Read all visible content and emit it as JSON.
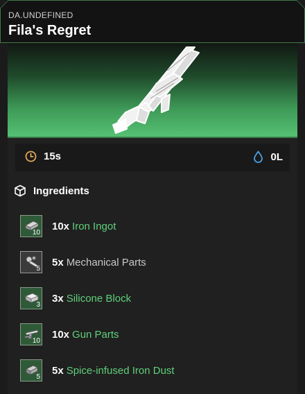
{
  "header": {
    "owner": "DA.UNDEFINED",
    "title": "Fila's Regret"
  },
  "hero": {
    "image_icon": "rifle-icon"
  },
  "stats": {
    "time": "15s",
    "time_icon": "clock-icon",
    "water": "0L",
    "water_icon": "water-drop-icon"
  },
  "ingredients_section": {
    "label": "Ingredients",
    "icon": "package-icon",
    "items": [
      {
        "count_badge": "10",
        "qty": "10x",
        "name": "Iron Ingot",
        "name_color": "#5fd07a",
        "slot_style": "green",
        "icon": "ingot-icon"
      },
      {
        "count_badge": "5",
        "qty": "5x",
        "name": "Mechanical Parts",
        "name_color": "#c8c8c8",
        "slot_style": "grey",
        "icon": "mechanical-parts-icon"
      },
      {
        "count_badge": "3",
        "qty": "3x",
        "name": "Silicone Block",
        "name_color": "#5fd07a",
        "slot_style": "green",
        "icon": "block-icon"
      },
      {
        "count_badge": "10",
        "qty": "10x",
        "name": "Gun Parts",
        "name_color": "#5fd07a",
        "slot_style": "green",
        "icon": "gun-parts-icon"
      },
      {
        "count_badge": "5",
        "qty": "5x",
        "name": "Spice-infused Iron Dust",
        "name_color": "#5fd07a",
        "slot_style": "green",
        "icon": "dust-icon"
      }
    ]
  },
  "colors": {
    "accent_green": "#5fd07a",
    "border_green": "#3f7a4a",
    "panel_bg": "#202020"
  }
}
